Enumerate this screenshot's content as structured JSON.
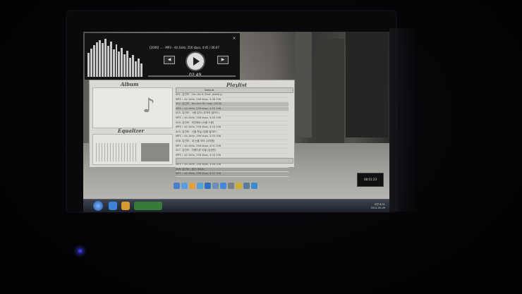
{
  "player": {
    "track_info": "[2006] ... - MP3 - 44.1kHz, 256 kbps, 4:05 / 06:07",
    "time": "02:49",
    "close": "×"
  },
  "album": {
    "title": "Album"
  },
  "equalizer": {
    "title": "Equalizer"
  },
  "playlist": {
    "title": "Playlist",
    "header_label": "Default",
    "rows": [
      "001. 김건모 - Can Do It (Feat. Jewelry)",
      "MP3 :: 44.1kHz, 256 kbps, 3:36 256",
      "002. 김건모 - You Are My Lady (2008)",
      "MP3 :: 44.1kHz, 256 kbps, 4:45 256",
      "003. 김건모 - 사랑 없이 (추억의 발라드)",
      "MP3 :: 44.1kHz, 256 kbps, 3:40 256",
      "004. 김건모 - 미안해요 (소울 스윙)",
      "MP3 :: 44.1kHz, 256 kbps, 4:10 256",
      "005. 김건모 - 서울 하늘 (정통 발라드)",
      "MP3 :: 44.1kHz, 256 kbps, 3:55 256",
      "006. 김건모 - 내 눈물 모아 (서지원)",
      "MP3 :: 44.1kHz, 256 kbps, 4:01 256",
      "007. 김건모 - 아름다운 이별 (김정민)",
      "MP3 :: 44.1kHz, 256 kbps, 4:20 256",
      "008. 김건모 - 잠 못드는 밤 비는 내리고",
      "MP3 :: 44.1kHz, 256 kbps, 3:48 256",
      "009. 김건모 - 짱가 (R&B)",
      "MP3 :: 44.1kHz, 256 kbps, 4:12 256",
      "010. 김건모 - 사랑이 떠나가네",
      "MP3 :: 44.1kHz, 256 kbps, 3:59 256"
    ]
  },
  "desktop": {
    "clock_widget": "08:01:23",
    "tray_time": "오전 8:01",
    "tray_date": "2012-05-09"
  },
  "colors": {
    "led": "#3b3bff",
    "player_bg": "#131313",
    "panel_bg": "#d9d8d3"
  }
}
